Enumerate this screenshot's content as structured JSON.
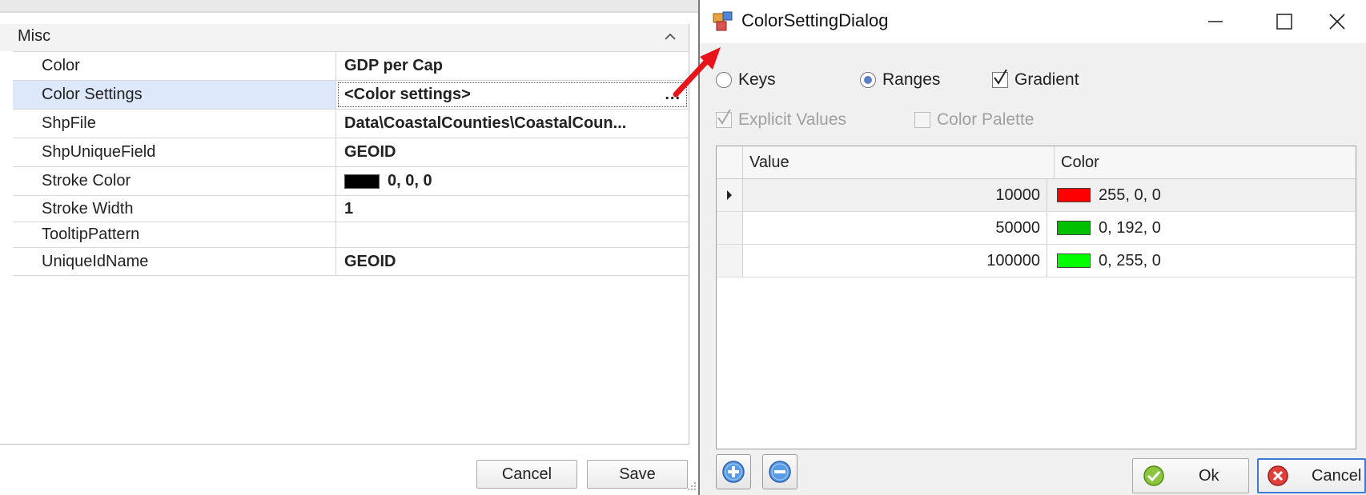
{
  "property_grid": {
    "category": "Misc",
    "rows": [
      {
        "name": "Color",
        "value": "GDP per Cap"
      },
      {
        "name": "Color Settings",
        "value": "<Color settings>",
        "button": "..."
      },
      {
        "name": "ShpFile",
        "value": "Data\\CoastalCounties\\CoastalCoun..."
      },
      {
        "name": "ShpUniqueField",
        "value": "GEOID"
      },
      {
        "name": "Stroke Color",
        "value": "0, 0, 0",
        "swatch": "#000000"
      },
      {
        "name": "Stroke Width",
        "value": "1"
      },
      {
        "name": "TooltipPattern",
        "value": ""
      },
      {
        "name": "UniqueIdName",
        "value": "GEOID"
      }
    ],
    "cancel_label": "Cancel",
    "save_label": "Save"
  },
  "dialog": {
    "title": "ColorSettingDialog",
    "options": {
      "keys_label": "Keys",
      "ranges_label": "Ranges",
      "gradient_label": "Gradient",
      "explicit_label": "Explicit Values",
      "palette_label": "Color Palette",
      "selected_mode": "Ranges",
      "gradient_checked": true,
      "explicit_checked": true,
      "explicit_enabled": false,
      "palette_checked": false,
      "palette_enabled": false
    },
    "grid": {
      "headers": {
        "value": "Value",
        "color": "Color"
      },
      "rows": [
        {
          "value": "10000",
          "color_text": "255, 0, 0",
          "color": "#ff0000"
        },
        {
          "value": "50000",
          "color_text": "0, 192, 0",
          "color": "#00c000"
        },
        {
          "value": "100000",
          "color_text": "0, 255, 0",
          "color": "#00ff00"
        }
      ]
    },
    "ok_label": "Ok",
    "cancel_label": "Cancel"
  },
  "icons": {
    "category_chevron": "chevron-up-icon",
    "app": "form-icon",
    "minimize": "minimize-icon",
    "maximize": "maximize-icon",
    "close": "close-icon",
    "row_indicator": "triangle-right-icon",
    "add": "plus-circle-icon",
    "remove": "minus-circle-icon",
    "ok": "check-circle-icon",
    "cancel": "x-circle-icon",
    "annotation": "red-arrow-icon"
  },
  "colors": {
    "selection": "#dde8fa",
    "accent": "#3b78d8",
    "annotation_red": "#e8141c"
  }
}
